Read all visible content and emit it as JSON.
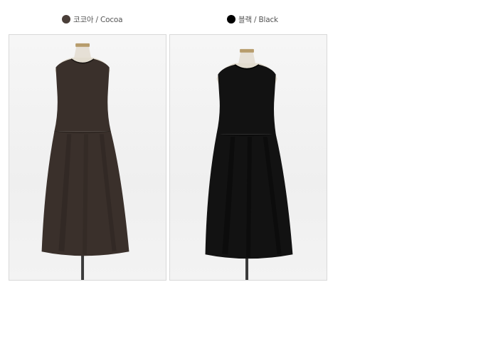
{
  "variants": [
    {
      "label": "코코아 / Cocoa",
      "swatch_color": "#4a3f39",
      "dress_color": "#3a302b",
      "dress_shade": "#2a221e"
    },
    {
      "label": "블랙 / Black",
      "swatch_color": "#000000",
      "dress_color": "#121212",
      "dress_shade": "#050505"
    }
  ]
}
